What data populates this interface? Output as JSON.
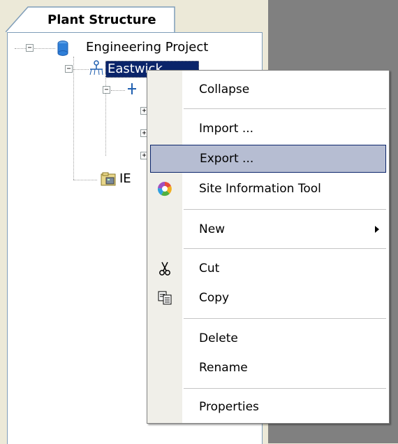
{
  "panel": {
    "tab_label": "Plant Structure"
  },
  "tree": {
    "root_label": "Engineering Project",
    "selected_label": "Eastwick",
    "ie_label": "IE"
  },
  "context_menu": {
    "items": [
      {
        "label": "Collapse"
      },
      {
        "label": "Import ..."
      },
      {
        "label": "Export ..."
      },
      {
        "label": "Site Information Tool"
      },
      {
        "label": "New"
      },
      {
        "label": "Cut"
      },
      {
        "label": "Copy"
      },
      {
        "label": "Delete"
      },
      {
        "label": "Rename"
      },
      {
        "label": "Properties"
      }
    ],
    "hovered": "Export ..."
  },
  "icons": {
    "root": "database-icon",
    "plant": "plant-icon",
    "ie": "folder-device-icon",
    "site_info": "color-wheel-icon",
    "cut": "scissors-icon",
    "copy": "copy-icon"
  },
  "colors": {
    "selection_bg": "#0a246a",
    "menu_hover_bg": "#b6bdd2",
    "menu_hover_border": "#0a246a",
    "background_gray": "#808080"
  }
}
